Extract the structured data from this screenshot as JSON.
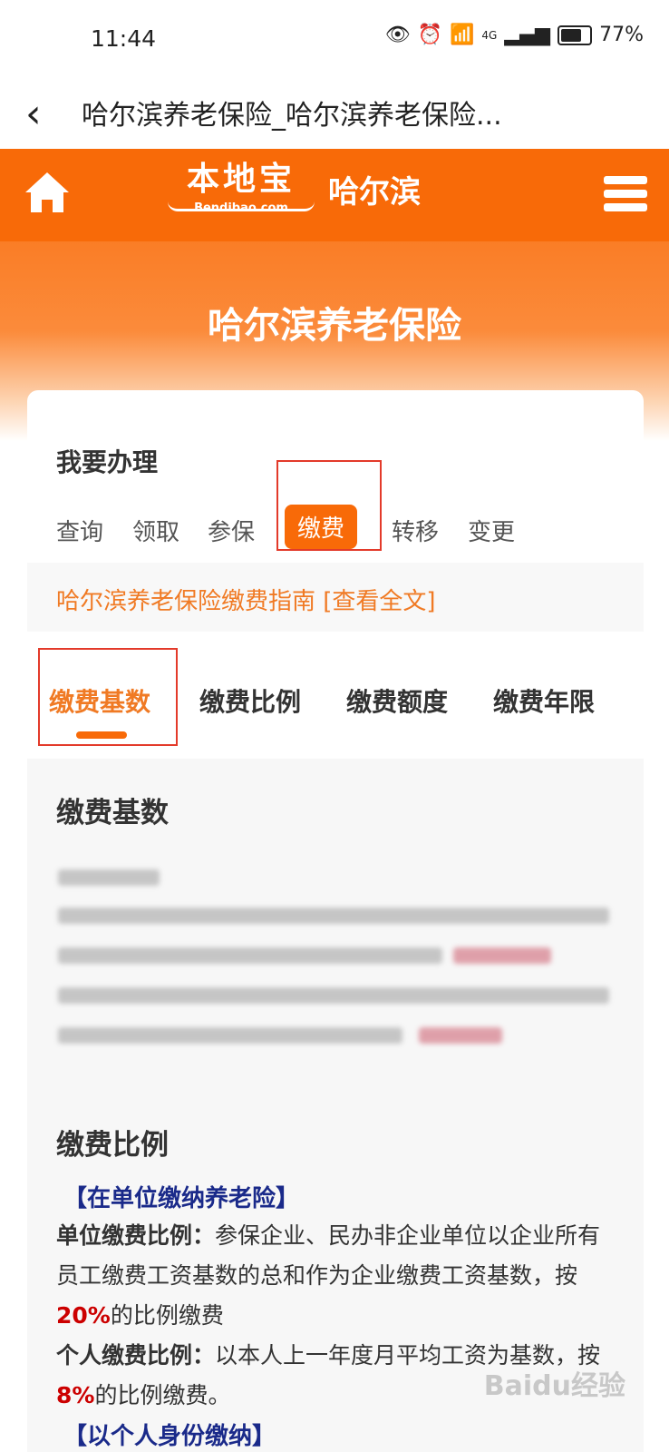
{
  "status_bar": {
    "time": "11:44",
    "battery": "77%",
    "network": "4G"
  },
  "titlebar": {
    "title": "哈尔滨养老保险_哈尔滨养老保险..."
  },
  "site": {
    "logo_cn": "本地宝",
    "logo_en": "Bendibao.com",
    "city": "哈尔滨"
  },
  "banner": {
    "title": "哈尔滨养老保险"
  },
  "section": {
    "heading": "我要办理"
  },
  "actions": [
    "查询",
    "领取",
    "参保",
    "缴费",
    "转移",
    "变更"
  ],
  "guide": {
    "text": "哈尔滨养老保险缴费指南 [查看全文]"
  },
  "tabs": [
    "缴费基数",
    "缴费比例",
    "缴费额度",
    "缴费年限"
  ],
  "content": {
    "base_title": "缴费基数",
    "ratio_title": "缴费比例",
    "employer_tag": "【在单位缴纳养老险】",
    "unit_label": "单位缴费比例：",
    "unit_text_a": "参保企业、民办非企业单位以企业所有员工缴费工资基数的总和作为企业缴费工资基数，按",
    "unit_rate": "20%",
    "unit_text_b": "的比例缴费",
    "personal_label": "个人缴费比例：",
    "personal_text_a": "以本人上一年度月平均工资为基数，按",
    "personal_rate": "8%",
    "personal_text_b": "的比例缴费。",
    "individual_tag": "【以个人身份缴纳】"
  },
  "watermark": "Baidu经验",
  "colors": {
    "brand_orange": "#f86a08",
    "highlight_red": "#cc0000",
    "tag_blue": "#1a2a8a",
    "annotation_red": "#e33a2a"
  }
}
